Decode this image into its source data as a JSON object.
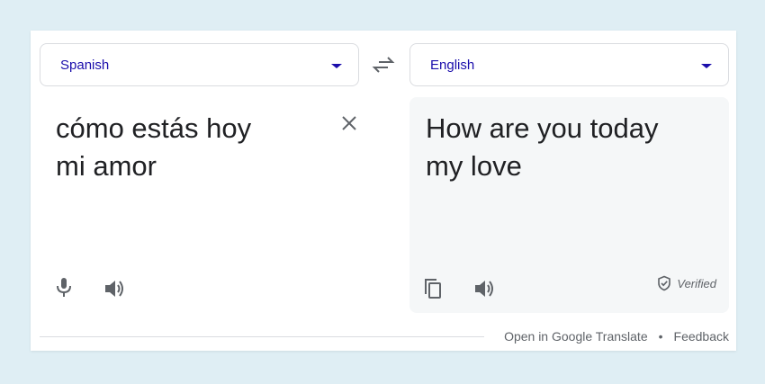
{
  "source": {
    "language": "Spanish",
    "text": "cómo estás hoy\nmi amor",
    "icons": [
      "close-icon",
      "microphone-icon",
      "speaker-icon"
    ]
  },
  "target": {
    "language": "English",
    "text": "How are you today\nmy love",
    "verified_label": "Verified",
    "icons": [
      "copy-icon",
      "speaker-icon",
      "verified-shield-icon"
    ]
  },
  "swap_icon": "swap-arrows-icon",
  "footer": {
    "open_link": "Open in Google Translate",
    "separator": "•",
    "feedback_link": "Feedback"
  },
  "colors": {
    "page_background": "#dfeef4",
    "card_background": "#ffffff",
    "target_pane_background": "#f5f7f8",
    "language_label": "#1a0dab",
    "text": "#202124",
    "icon_gray": "#5f6368"
  }
}
